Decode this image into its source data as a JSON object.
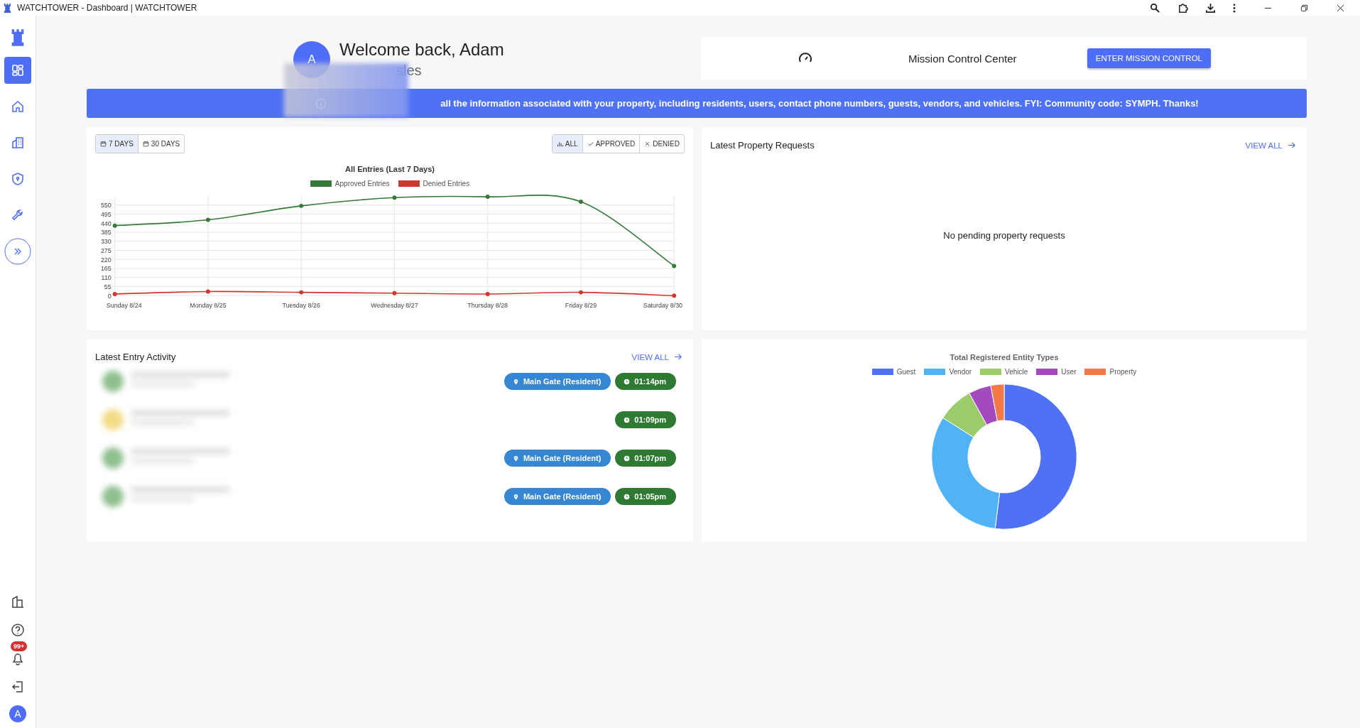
{
  "window": {
    "title": "WATCHTOWER - Dashboard | WATCHTOWER"
  },
  "sidebar": {
    "items": [
      {
        "kind": "dashboard",
        "selected": true
      },
      {
        "kind": "home",
        "selected": false
      },
      {
        "kind": "building",
        "selected": false
      },
      {
        "kind": "shield",
        "selected": false
      },
      {
        "kind": "wrench",
        "selected": false
      }
    ],
    "bottom": {
      "notifications_badge": "99+",
      "avatar": "A"
    }
  },
  "header": {
    "avatar": "A",
    "greeting": "Welcome back, Adam",
    "subtitle": "sles"
  },
  "mission": {
    "title": "Mission Control Center",
    "button": "ENTER MISSION CONTROL"
  },
  "banner": {
    "text": "all the information associated with your property, including residents, users, contact phone numbers, guests, vendors, and vehicles. FYI: Community code: SYMPH. Thanks!"
  },
  "entries_chart": {
    "ranges": [
      {
        "label": "7 DAYS",
        "selected": true
      },
      {
        "label": "30 DAYS",
        "selected": false
      }
    ],
    "filters": [
      {
        "kind": "all",
        "label": "ALL",
        "selected": true
      },
      {
        "kind": "approved",
        "label": "APPROVED",
        "selected": false
      },
      {
        "kind": "denied",
        "label": "DENIED",
        "selected": false
      }
    ],
    "chart_data": {
      "type": "line",
      "title": "All Entries (Last 7 Days)",
      "categories": [
        "Sunday 8/24",
        "Monday 8/25",
        "Tuesday 8/26",
        "Wednesday 8/27",
        "Thursday 8/28",
        "Friday 8/29",
        "Saturday 8/30"
      ],
      "series": [
        {
          "name": "Approved Entries",
          "color": "#357a38",
          "marker": true,
          "values": [
            425,
            460,
            545,
            595,
            600,
            570,
            180
          ]
        },
        {
          "name": "Denied Entries",
          "color": "#d0382f",
          "marker": true,
          "values": [
            10,
            25,
            20,
            15,
            10,
            20,
            0
          ]
        }
      ],
      "grid": true,
      "ylim": [
        0,
        605
      ],
      "yticks": [
        0,
        55,
        110,
        165,
        220,
        275,
        330,
        385,
        440,
        495,
        550
      ]
    }
  },
  "property_requests": {
    "title": "Latest Property Requests",
    "link": "VIEW ALL",
    "empty": "No pending property requests"
  },
  "entry_activity": {
    "title": "Latest Entry Activity",
    "link": "VIEW ALL",
    "rows": [
      {
        "color": "#8fbf8f",
        "location": "Main Gate (Resident)",
        "time": "01:14pm"
      },
      {
        "color": "#f2dc85",
        "time": "01:09pm"
      },
      {
        "color": "#8fbf8f",
        "location": "Main Gate (Resident)",
        "time": "01:07pm"
      },
      {
        "color": "#8fbf8f",
        "location": "Main Gate (Resident)",
        "time": "01:05pm"
      }
    ]
  },
  "entity_types": {
    "title": "Total Registered Entity Types",
    "legend": [
      {
        "name": "Guest",
        "color": "#4f72f5"
      },
      {
        "name": "Vendor",
        "color": "#4fb3f5"
      },
      {
        "name": "Vehicle",
        "color": "#9ccb6a"
      },
      {
        "name": "User",
        "color": "#a34bbd"
      },
      {
        "name": "Property",
        "color": "#f5784a"
      }
    ]
  }
}
